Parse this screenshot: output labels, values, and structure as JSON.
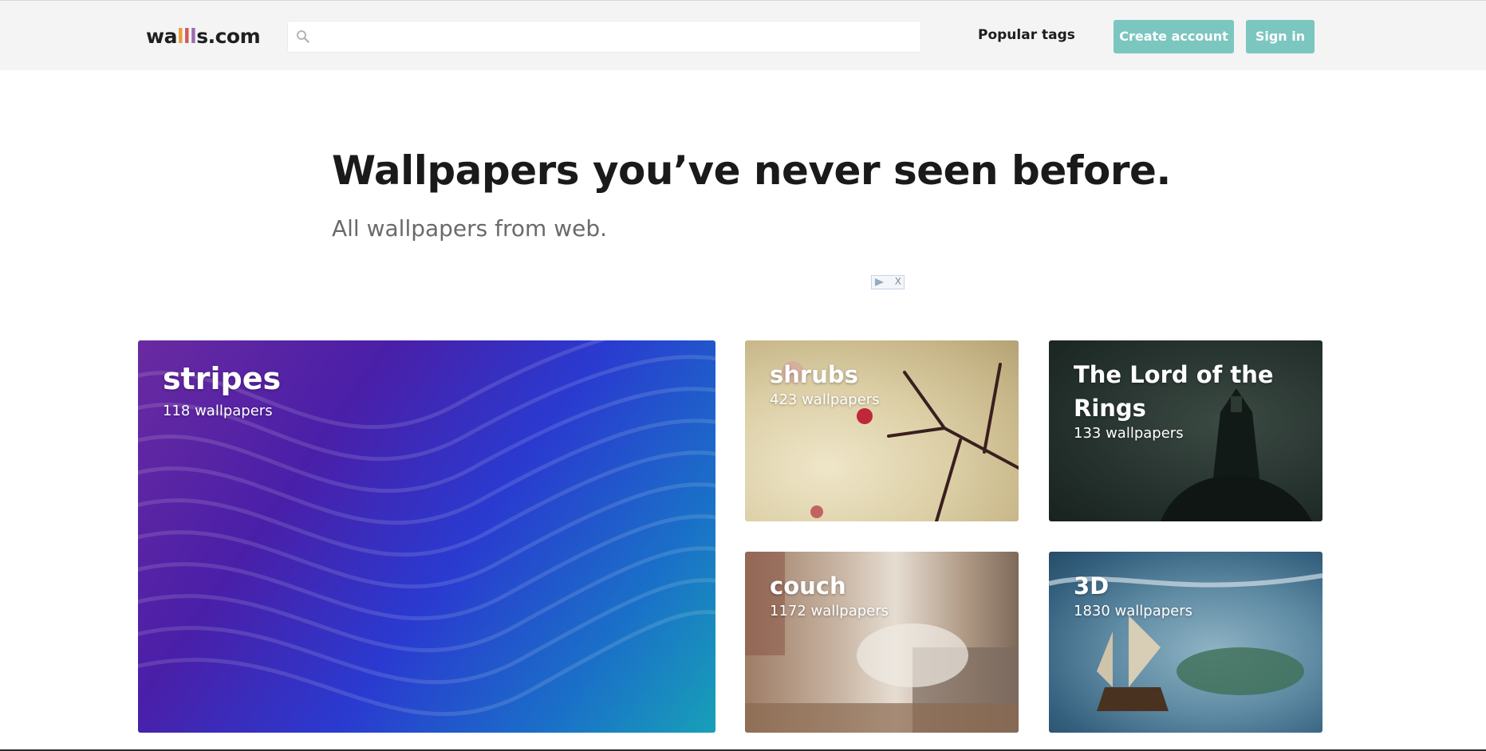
{
  "header": {
    "logo": {
      "prefix": "wa",
      "l1": "l",
      "l2": "l",
      "l3": "l",
      "suffix": "s.com"
    },
    "search": {
      "placeholder": "",
      "value": ""
    },
    "nav": {
      "popular_tags": "Popular tags"
    },
    "buttons": {
      "create_account": "Create account",
      "sign_in": "Sign in"
    },
    "colors": {
      "accent": "#7cc6c0",
      "topbar_bg": "#f4f4f4"
    },
    "icons": {
      "search": "search-icon"
    }
  },
  "hero": {
    "title": "Wallpapers you’ve never seen before.",
    "subtitle": "All wallpapers from web."
  },
  "ad": {
    "icons": [
      "ad-play-icon",
      "ad-close-icon"
    ],
    "close_glyph": "X"
  },
  "tags": [
    {
      "name": "stripes",
      "count": "118 wallpapers"
    },
    {
      "name": "shrubs",
      "count": "423 wallpapers"
    },
    {
      "name": "The Lord of the Rings",
      "count": "133 wallpapers"
    },
    {
      "name": "couch",
      "count": "1172 wallpapers"
    },
    {
      "name": "3D",
      "count": "1830 wallpapers"
    }
  ]
}
